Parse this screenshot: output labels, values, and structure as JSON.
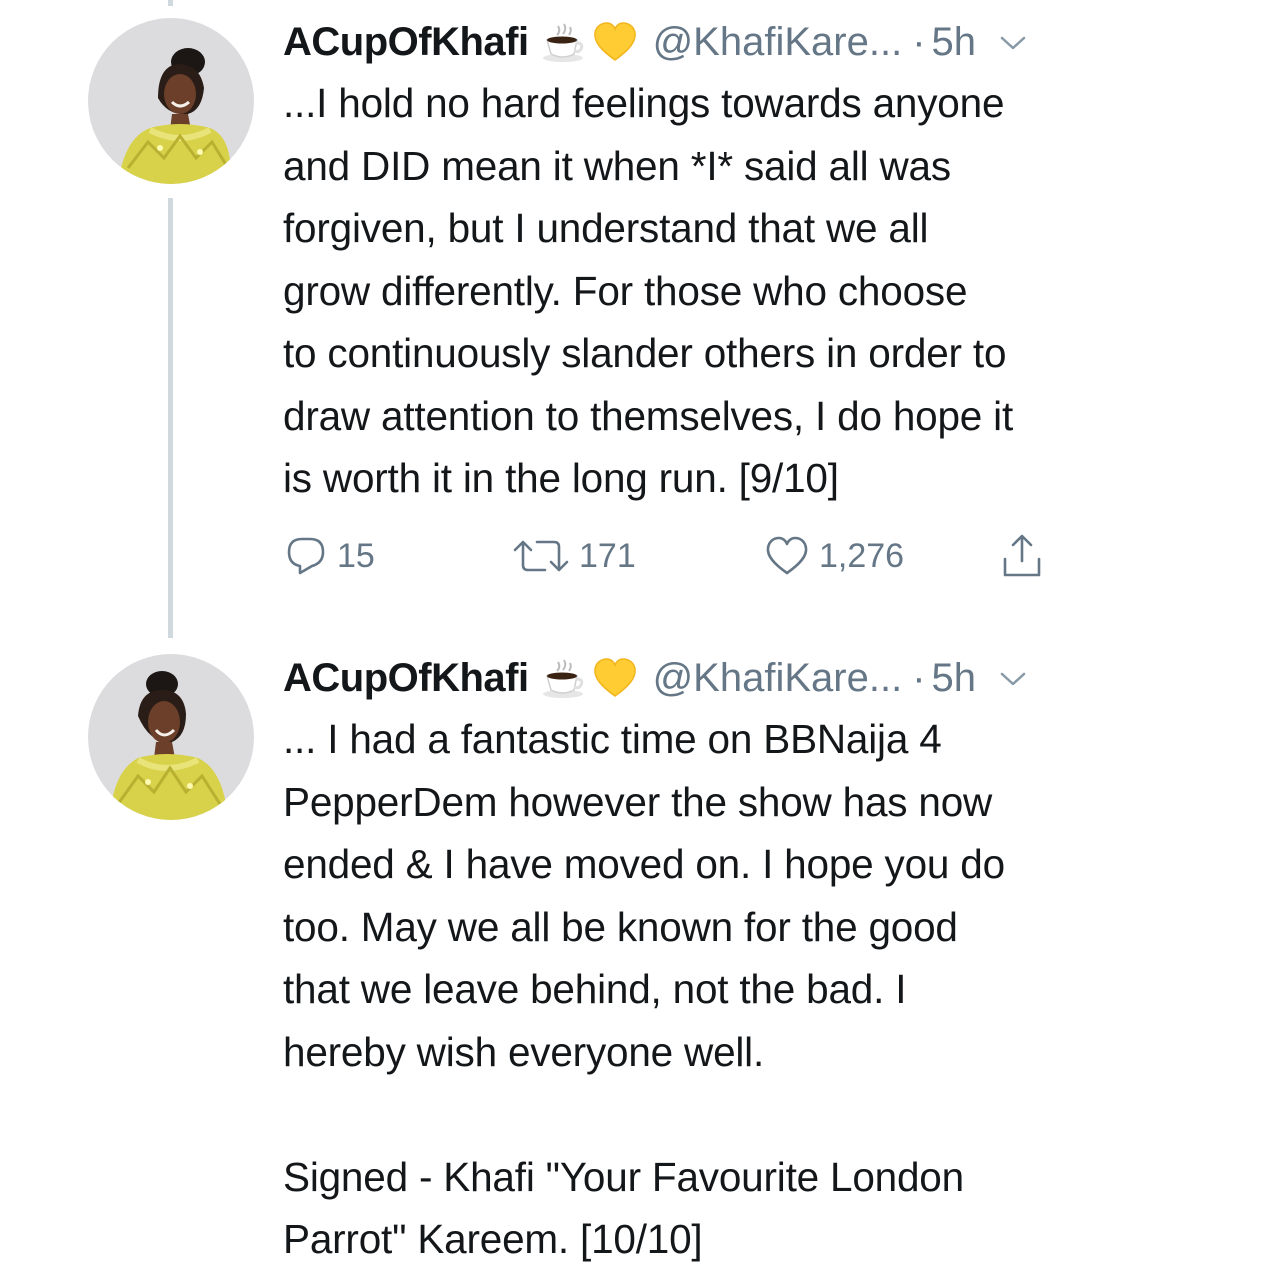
{
  "tweets": [
    {
      "display_name": "ACupOfKhafi",
      "emojis": [
        "coffee-cup-icon",
        "yellow-heart-icon"
      ],
      "handle": "@KhafiKare...",
      "separator": "·",
      "time": "5h",
      "text": "...I hold no hard feelings towards anyone\nand DID mean it when *I* said all was\nforgiven, but I understand that we all\ngrow differently. For those who choose\nto continuously slander others in order to\ndraw attention to themselves, I do hope it\nis worth it in the long run. [9/10]",
      "replies": "15",
      "retweets": "171",
      "likes": "1,276"
    },
    {
      "display_name": "ACupOfKhafi",
      "emojis": [
        "coffee-cup-icon",
        "yellow-heart-icon"
      ],
      "handle": "@KhafiKare...",
      "separator": "·",
      "time": "5h",
      "text": "... I had a fantastic time on BBNaija 4\nPepperDem however the show has now\nended & I have moved on. I hope you do\ntoo. May we all be known for the good\nthat we leave behind, not the bad. I\nhereby wish everyone well.\n\nSigned - Khafi \"Your Favourite London\nParrot\" Kareem. [10/10]"
    }
  ],
  "colors": {
    "text": "#14171a",
    "secondary": "#657786",
    "thread_line": "#cfd9de",
    "heart_emoji": "#ffcc33"
  }
}
